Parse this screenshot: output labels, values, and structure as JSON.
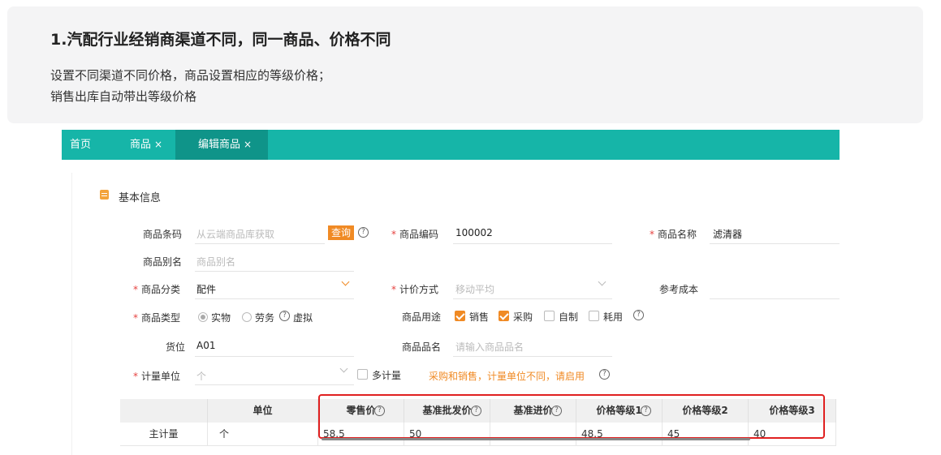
{
  "intro": {
    "title": "1.汽配行业经销商渠道不同，同一商品、价格不同",
    "line1": "设置不同渠道不同价格，商品设置相应的等级价格；",
    "line2": "销售出库自动带出等级价格"
  },
  "tabs": {
    "home": "首页",
    "goods": "商品",
    "edit": "编辑商品",
    "close_glyph": "×"
  },
  "section": {
    "title": "基本信息"
  },
  "form": {
    "barcode_label": "商品条码",
    "barcode_placeholder": "从云端商品库获取",
    "query_button": "查询",
    "code_label": "商品编码",
    "code_value": "100002",
    "name_label": "商品名称",
    "name_value": "滤清器",
    "alias_label": "商品别名",
    "alias_placeholder": "商品别名",
    "category_label": "商品分类",
    "category_value": "配件",
    "pricing_label": "计价方式",
    "pricing_placeholder": "移动平均",
    "ref_cost_label": "参考成本",
    "type_label": "商品类型",
    "type_options": [
      "实物",
      "劳务",
      "虚拟"
    ],
    "usage_label": "商品用途",
    "usage_options": [
      "销售",
      "采购",
      "自制",
      "耗用"
    ],
    "location_label": "货位",
    "location_value": "A01",
    "product_name_label": "商品品名",
    "product_name_placeholder": "请输入商品品名",
    "unit_label": "计量单位",
    "unit_placeholder": "个",
    "multi_unit_label": "多计量",
    "unit_warning": "采购和销售，计量单位不同，请启用",
    "required_mark": "*",
    "help_glyph": "?"
  },
  "price_table": {
    "headers": [
      "单位",
      "零售价",
      "基准批发价",
      "基准进价",
      "价格等级1",
      "价格等级2",
      "价格等级3"
    ],
    "row": {
      "label": "主计量",
      "unit": "个",
      "retail": "58.5",
      "wholesale": "50",
      "purchase": "",
      "level1": "48.5",
      "level2": "45",
      "level3": "40"
    }
  },
  "colors": {
    "teal": "#16b5a8",
    "orange": "#f08a24",
    "red": "#e02020"
  }
}
